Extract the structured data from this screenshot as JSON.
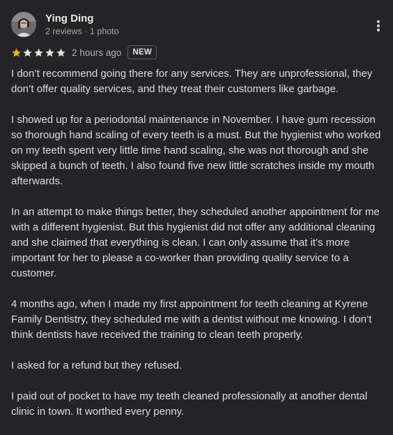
{
  "author": {
    "name": "Ying Ding",
    "meta": "2 reviews · 1 photo"
  },
  "rating": {
    "stars": 1,
    "max_stars": 5,
    "time": "2 hours ago",
    "badge": "NEW"
  },
  "colors": {
    "background": "#242427",
    "star_filled": "#fbbc04",
    "star_empty": "#e1e1e1"
  },
  "icons": [
    "avatar-photo",
    "star-icon",
    "more-vert-icon"
  ],
  "review": {
    "paragraphs": [
      "I don’t recommend going there for any services. They are unprofessional, they don’t offer quality services, and they treat their customers like garbage.",
      "I showed up for a periodontal maintenance in November. I have gum recession so thorough hand scaling of every teeth is a must. But the hygienist who worked on my teeth spent very little time hand scaling, she was not thorough and she skipped a bunch of teeth. I also found five new little scratches inside my mouth afterwards.",
      "In an attempt to make things better, they scheduled another appointment for me with a different hygienist. But this hygienist did not offer any additional cleaning and she claimed that everything is clean. I can only assume that it’s more important for her to please a co-worker than providing quality service to a customer.",
      "4 months ago, when I made my first appointment for teeth cleaning at Kyrene Family Dentistry, they scheduled me with a dentist without me knowing. I don’t think dentists have received the training to clean teeth properly.",
      "I asked for a refund but they refused.",
      "I paid out of pocket to have my teeth cleaned professionally at another dental clinic in town. It worthed every penny."
    ]
  }
}
